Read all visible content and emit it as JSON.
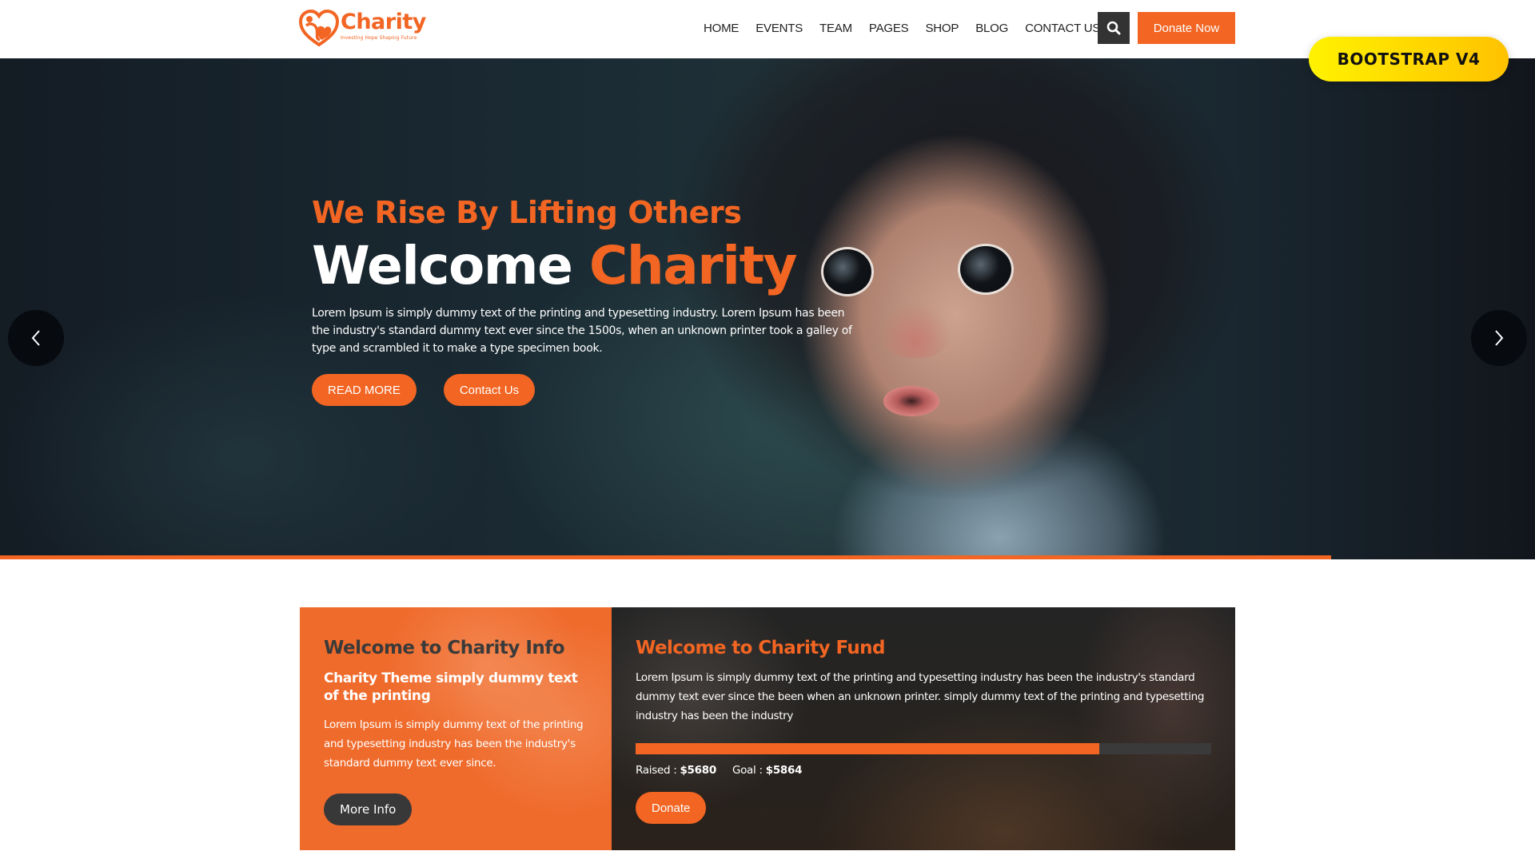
{
  "header": {
    "logo": {
      "name": "Charity",
      "tagline": "Investing Hope Shaping Future"
    },
    "nav": [
      {
        "label": "HOME"
      },
      {
        "label": "EVENTS"
      },
      {
        "label": "TEAM"
      },
      {
        "label": "PAGES"
      },
      {
        "label": "SHOP"
      },
      {
        "label": "BLOG"
      },
      {
        "label": "CONTACT US"
      }
    ],
    "search_icon": "search-icon",
    "donate_now_label": "Donate Now"
  },
  "badge": {
    "label": "BOOTSTRAP V4"
  },
  "hero": {
    "tagline": "We Rise By Lifting Others",
    "title_plain": "Welcome",
    "title_accent": "Charity",
    "description": "Lorem Ipsum is simply dummy text of the printing and typesetting industry. Lorem Ipsum has been the industry's standard dummy text ever since the 1500s, when an unknown printer took a galley of type and scrambled it to make a type specimen book.",
    "read_more_label": "READ MORE",
    "contact_label": "Contact Us",
    "prev_icon": "chevron-left-icon",
    "next_icon": "chevron-right-icon",
    "slide_progress_percent": 86.7
  },
  "info": {
    "title": "Welcome to Charity Info",
    "subtitle": "Charity Theme simply dummy text of the printing",
    "text": "Lorem Ipsum is simply dummy text of the printing and typesetting industry has been the industry's standard dummy text ever since.",
    "button_label": "More Info"
  },
  "fund": {
    "title": "Welcome to Charity Fund",
    "text": "Lorem Ipsum is simply dummy text of the printing and typesetting industry has been the industry's standard dummy text ever since the been when an unknown printer. simply dummy text of the printing and typesetting industry has been the industry",
    "progress_percent": 80.5,
    "raised_label": "Raised :",
    "raised_value": "$5680",
    "goal_label": "Goal :",
    "goal_value": "$5864",
    "button_label": "Donate"
  },
  "colors": {
    "accent": "#f26522",
    "dark_button": "#333333",
    "badge_yellow": "#ffd500"
  }
}
